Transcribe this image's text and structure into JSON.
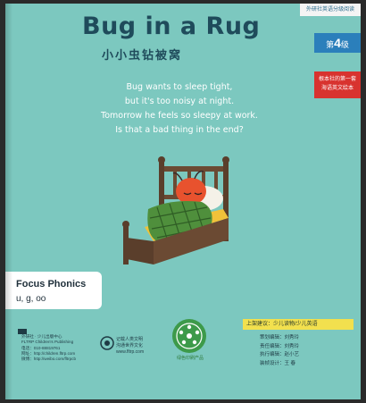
{
  "cover": {
    "title": "Bug in a Rug",
    "subtitle": "小小虫钻被窝",
    "series_tab": "外研社英语分级阅读",
    "level_prefix": "第",
    "level_number": "4",
    "level_suffix": "级",
    "red_tab_line1": "根本社的第一套",
    "red_tab_line2": "海语英文绘本",
    "story_lines": [
      "Bug wants to sleep tight,",
      "but it's too noisy at night.",
      "Tomorrow he feels so sleepy at work.",
      "Is that a bad thing in the end?"
    ],
    "focus_title": "Focus Phonics",
    "focus_sub": "u, g, oo"
  },
  "back_info": {
    "publisher_lines": [
      "外研社 · 少儿出版中心",
      "FLTRP Children's Publishing",
      "电话：010-88819761",
      "网址：http://children.fltrp.com",
      "微博：http://weibo.com/fltrpcb"
    ],
    "mid_logo_line1": "记载人类文明",
    "mid_logo_line2": "沟通世界文化",
    "mid_logo_line3": "www.fltrp.com",
    "green_caption": "绿色印刷产品",
    "recommend": "上架建议：少儿读物/少儿英语",
    "credits": [
      "策划编辑：刘秀玲",
      "责任编辑：刘秀玲",
      "执行编辑：赵小艺",
      "装帧设计：王  春"
    ]
  },
  "colors": {
    "background": "#7cc8bf",
    "title": "#1f4b5b",
    "level_tab": "#2b7fbb",
    "red_tab": "#d8332f",
    "recommend_bar": "#f2e04e"
  }
}
